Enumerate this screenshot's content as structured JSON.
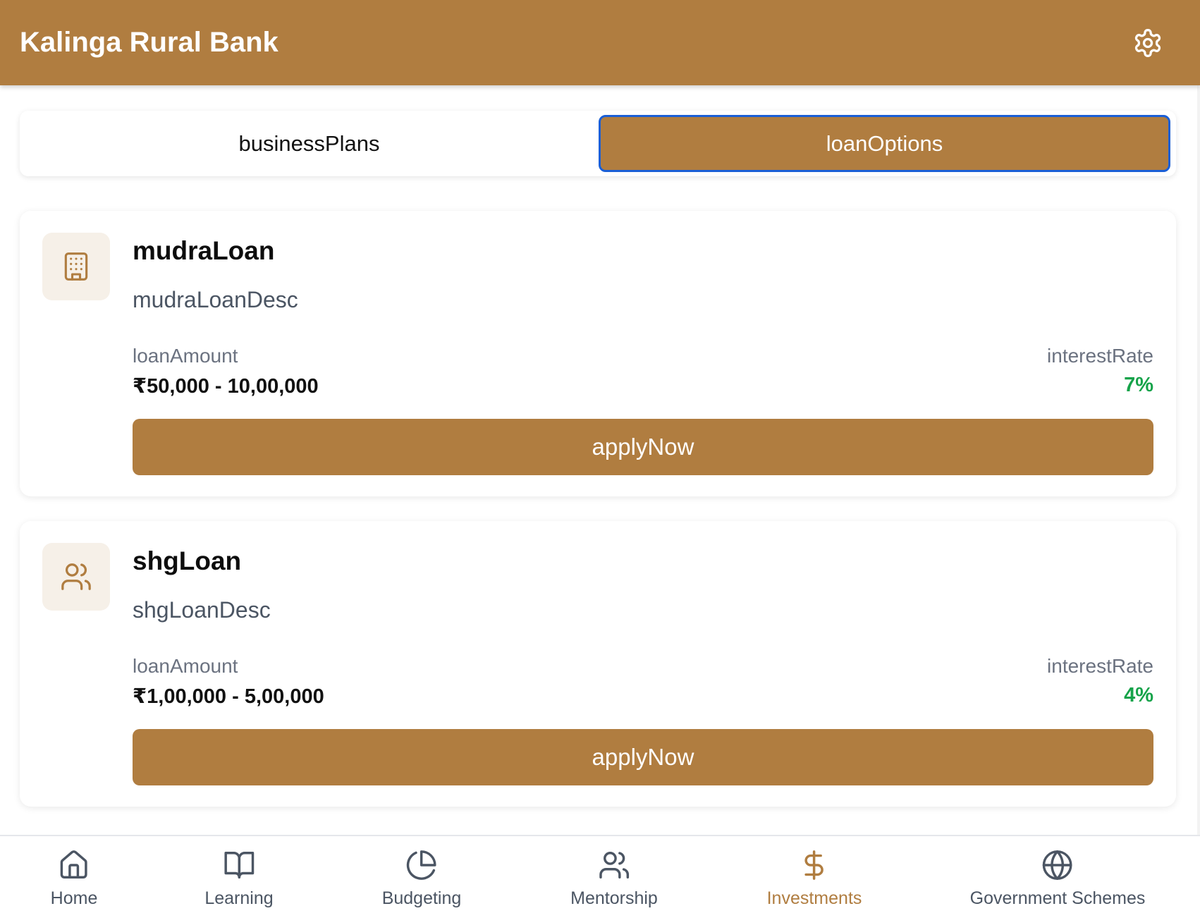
{
  "header": {
    "title": "Kalinga Rural Bank",
    "settings_icon": "gear-icon"
  },
  "tabs": [
    {
      "label": "businessPlans",
      "active": false
    },
    {
      "label": "loanOptions",
      "active": true
    }
  ],
  "loans": [
    {
      "icon": "building-icon",
      "title": "mudraLoan",
      "description": "mudraLoanDesc",
      "amount_label": "loanAmount",
      "amount_value": "₹50,000 - 10,00,000",
      "rate_label": "interestRate",
      "rate_value": "7%",
      "apply_label": "applyNow"
    },
    {
      "icon": "users-icon",
      "title": "shgLoan",
      "description": "shgLoanDesc",
      "amount_label": "loanAmount",
      "amount_value": "₹1,00,000 - 5,00,000",
      "rate_label": "interestRate",
      "rate_value": "4%",
      "apply_label": "applyNow"
    }
  ],
  "bottom_nav": [
    {
      "label": "Home",
      "icon": "home-icon",
      "active": false
    },
    {
      "label": "Learning",
      "icon": "book-icon",
      "active": false
    },
    {
      "label": "Budgeting",
      "icon": "pie-chart-icon",
      "active": false
    },
    {
      "label": "Mentorship",
      "icon": "users-icon",
      "active": false
    },
    {
      "label": "Investments",
      "icon": "dollar-icon",
      "active": true
    },
    {
      "label": "Government Schemes",
      "icon": "globe-icon",
      "active": false
    }
  ],
  "colors": {
    "brand": "#b07d40",
    "active_tab_border": "#1a5fd6",
    "rate_green": "#16a34a",
    "icon_bg": "#f6f0e8"
  }
}
